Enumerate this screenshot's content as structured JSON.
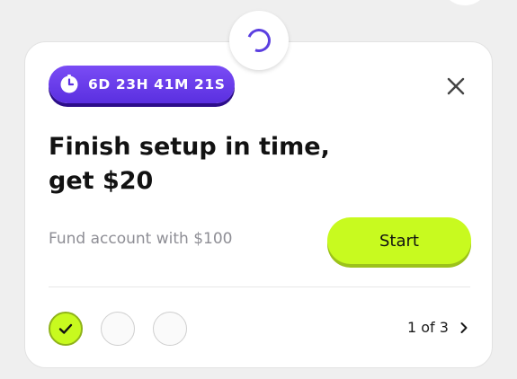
{
  "offer_card": {
    "timer": {
      "icon": "clock-icon",
      "countdown": "6D 23H 41M 21S"
    },
    "close_icon": "close-icon",
    "headline_line1": "Finish setup in time,",
    "headline_line2": "get $20",
    "task_description": "Fund account with $100",
    "start_button_label": "Start",
    "steps": [
      {
        "state": "completed",
        "icon": "check-icon"
      },
      {
        "state": "pending"
      },
      {
        "state": "pending"
      }
    ],
    "pager": {
      "label": "1 of 3",
      "next_icon": "chevron-right-icon"
    }
  },
  "loading_indicator": "spinner-icon",
  "colors": {
    "page_background": "#efefef",
    "card_background": "#ffffff",
    "timer_purple": "#6a3cf0",
    "timer_shadow": "#2c0d8a",
    "accent_lime": "#c8fa1f",
    "accent_lime_shadow": "#9cc21a",
    "spinner": "#5b3fe0",
    "muted_text": "#8e8e95",
    "headline_text": "#121212"
  }
}
